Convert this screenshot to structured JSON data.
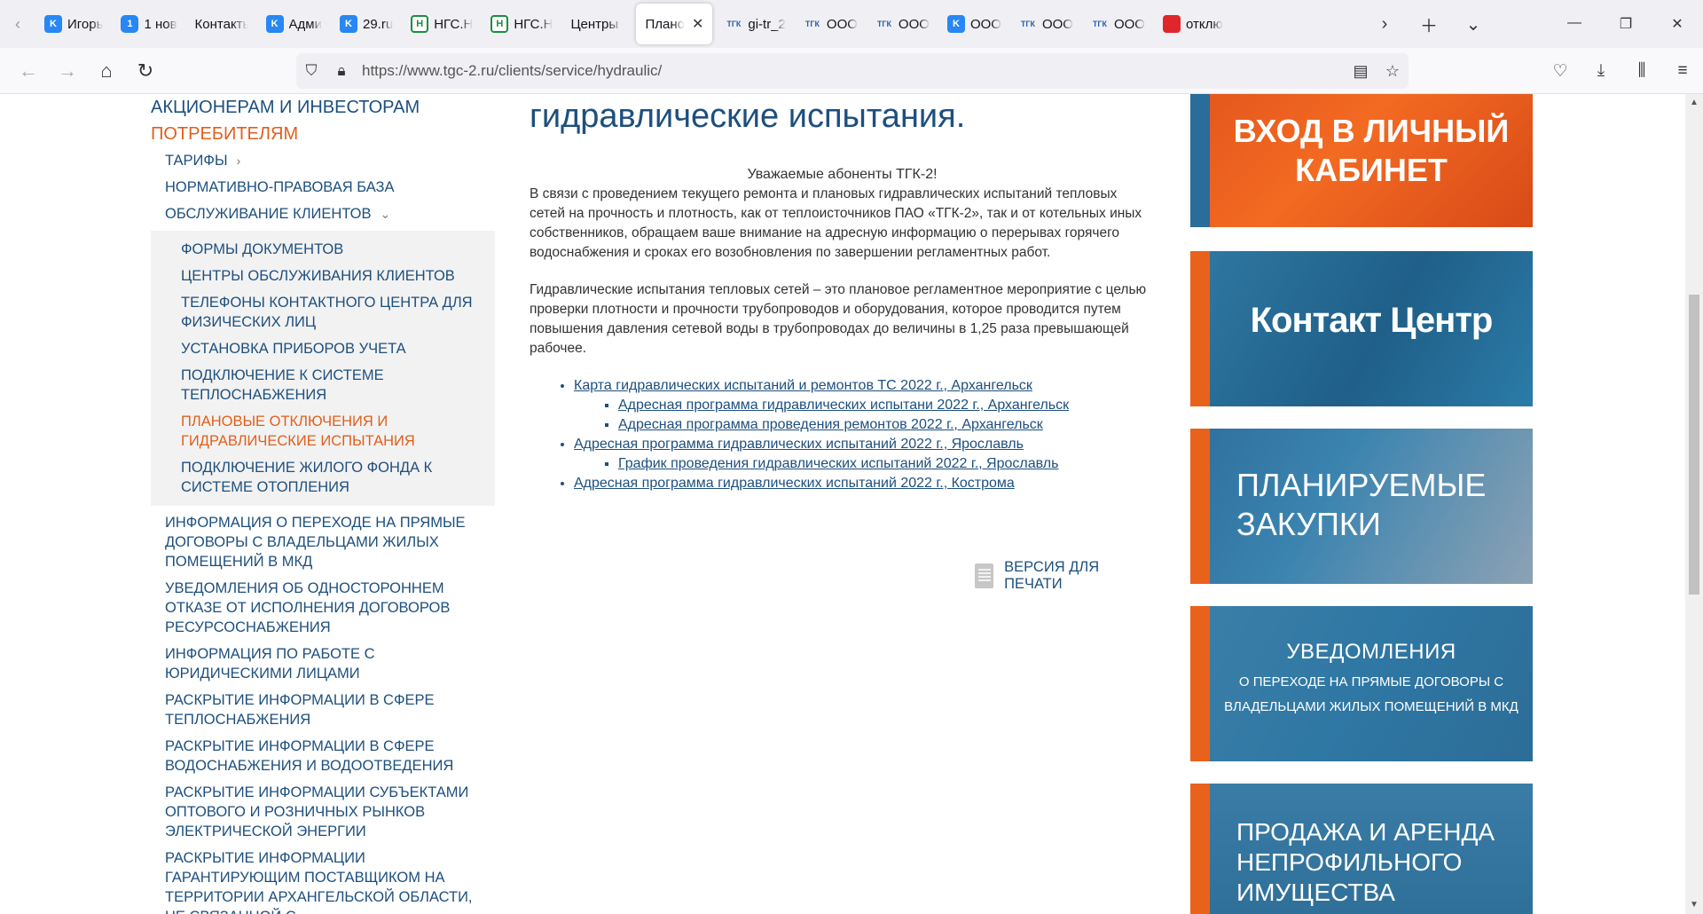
{
  "browser": {
    "tabs": [
      {
        "title": "Игорь",
        "fav": "vk",
        "favtext": "K"
      },
      {
        "title": "1 нов",
        "fav": "num",
        "favtext": "1"
      },
      {
        "title": "Контакты",
        "fav": "none",
        "favtext": ""
      },
      {
        "title": "Адми",
        "fav": "vk",
        "favtext": "K"
      },
      {
        "title": "29.ru",
        "fav": "vk",
        "favtext": "K"
      },
      {
        "title": "НГС.Н",
        "fav": "ngs",
        "favtext": "Н"
      },
      {
        "title": "НГС.Н",
        "fav": "ngs",
        "favtext": "Н"
      },
      {
        "title": "Центры о",
        "fav": "none",
        "favtext": ""
      },
      {
        "title": "Плано",
        "fav": "none",
        "favtext": "",
        "active": true
      },
      {
        "title": "gi-tr_2",
        "fav": "tgc",
        "favtext": "ТГК"
      },
      {
        "title": "ООО",
        "fav": "tgc",
        "favtext": "ТГК"
      },
      {
        "title": "ООО",
        "fav": "tgc",
        "favtext": "ТГК"
      },
      {
        "title": "ООО",
        "fav": "vk",
        "favtext": "K"
      },
      {
        "title": "ООО",
        "fav": "tgc",
        "favtext": "ТГК"
      },
      {
        "title": "ООО",
        "fav": "tgc",
        "favtext": "ТГК"
      },
      {
        "title": "отклю",
        "fav": "red",
        "favtext": ""
      }
    ],
    "url_host": "https://www.tgc-2.ru",
    "url_path": "/clients/service/hydraulic/"
  },
  "menu": {
    "sect_investors": "АКЦИОНЕРАМ И ИНВЕСТОРАМ",
    "sect_consumers": "ПОТРЕБИТЕЛЯМ",
    "tariffs": "ТАРИФЫ",
    "legal": "НОРМАТИВНО-ПРАВОВАЯ БАЗА",
    "service": "ОБСЛУЖИВАНИЕ КЛИЕНТОВ",
    "sub": [
      "ФОРМЫ ДОКУМЕНТОВ",
      "ЦЕНТРЫ ОБСЛУЖИВАНИЯ КЛИЕНТОВ",
      "ТЕЛЕФОНЫ КОНТАКТНОГО ЦЕНТРА ДЛЯ ФИЗИЧЕСКИХ ЛИЦ",
      "УСТАНОВКА ПРИБОРОВ УЧЕТА",
      "ПОДКЛЮЧЕНИЕ К СИСТЕМЕ ТЕПЛОСНАБЖЕНИЯ",
      "ПЛАНОВЫЕ ОТКЛЮЧЕНИЯ И ГИДРАВЛИЧЕСКИЕ ИСПЫТАНИЯ",
      "ПОДКЛЮЧЕНИЕ ЖИЛОГО ФОНДА К СИСТЕМЕ ОТОПЛЕНИЯ"
    ],
    "rest": [
      "ИНФОРМАЦИЯ О ПЕРЕХОДЕ НА ПРЯМЫЕ ДОГОВОРЫ С ВЛАДЕЛЬЦАМИ ЖИЛЫХ ПОМЕЩЕНИЙ В МКД",
      "УВЕДОМЛЕНИЯ ОБ ОДНОСТОРОННЕМ ОТКАЗЕ ОТ ИСПОЛНЕНИЯ ДОГОВОРОВ РЕСУРСОСНАБЖЕНИЯ",
      "ИНФОРМАЦИЯ ПО РАБОТЕ С ЮРИДИЧЕСКИМИ ЛИЦАМИ",
      "РАСКРЫТИЕ ИНФОРМАЦИИ В СФЕРЕ ТЕПЛОСНАБЖЕНИЯ",
      "РАСКРЫТИЕ ИНФОРМАЦИИ В СФЕРЕ ВОДОСНАБЖЕНИЯ И ВОДООТВЕДЕНИЯ",
      "РАСКРЫТИЕ ИНФОРМАЦИИ СУБЪЕКТАМИ ОПТОВОГО И РОЗНИЧНЫХ РЫНКОВ ЭЛЕКТРИЧЕСКОЙ ЭНЕРГИИ",
      "РАСКРЫТИЕ ИНФОРМАЦИИ ГАРАНТИРУЮЩИМ ПОСТАВЩИКОМ НА ТЕРРИТОРИИ АРХАНГЕЛЬСКОЙ ОБЛАСТИ, НЕ СВЯЗАННОЙ С"
    ]
  },
  "content": {
    "heading": "гидравлические испытания.",
    "greeting": "Уважаемые абоненты ТГК-2!",
    "para1": "В связи с проведением текущего ремонта и плановых гидравлических испытаний тепловых сетей на прочность и плотность, как от теплоисточников ПАО «ТГК-2», так и от котельных иных собственников, обращаем ваше внимание на адресную информацию о перерывах горячего водоснабжения и сроках его возобновления по завершении регламентных работ.",
    "para2": "Гидравлические испытания тепловых сетей – это плановое регламентное мероприятие с целью проверки плотности и прочности трубопроводов и оборудования, которое проводится путем повышения давления сетевой воды в трубопроводах до величины в 1,25 раза превышающей рабочее.",
    "links": [
      {
        "text": "Карта гидравлических испытаний и ремонтов ТС 2022 г., Архангельск",
        "level": 1
      },
      {
        "text": "Адресная программа гидравлических испытани 2022 г., Архангельск",
        "level": 2
      },
      {
        "text": "Адресная программа проведения ремонтов 2022 г., Архангельск",
        "level": 2
      },
      {
        "text": "Адресная программа гидравлических испытаний 2022 г., Ярославль",
        "level": 1
      },
      {
        "text": "График проведения гидравлических испытаний 2022 г., Ярославль",
        "level": 2
      },
      {
        "text": "Адресная программа гидравлических испытаний 2022 г., Кострома",
        "level": 1
      }
    ],
    "print": "ВЕРСИЯ ДЛЯ ПЕЧАТИ"
  },
  "banners": {
    "b1": "ВХОД В ЛИЧНЫЙ КАБИНЕТ",
    "b2": "Контакт Центр",
    "b3": "ПЛАНИРУЕМЫЕ ЗАКУПКИ",
    "b4_title": "УВЕДОМЛЕНИЯ",
    "b4_sub": "О ПЕРЕХОДЕ НА ПРЯМЫЕ ДОГОВОРЫ С ВЛАДЕЛЬЦАМИ ЖИЛЫХ ПОМЕЩЕНИЙ В МКД",
    "b5": "ПРОДАЖА И АРЕНДА НЕПРОФИЛЬНОГО ИМУЩЕСТВА"
  },
  "colors": {
    "brand_blue": "#1d4f7e",
    "accent_orange": "#e25e1a"
  }
}
